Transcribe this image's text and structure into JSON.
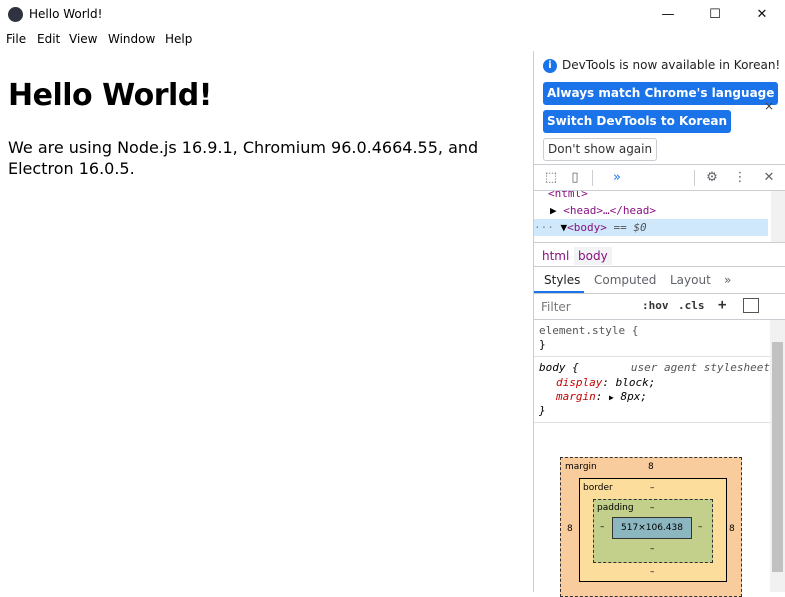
{
  "window": {
    "title": "Hello World!",
    "minimize": "—",
    "maximize": "☐",
    "close": "✕"
  },
  "menu": [
    "File",
    "Edit",
    "View",
    "Window",
    "Help"
  ],
  "page": {
    "heading": "Hello World!",
    "paragraph": "We are using Node.js 16.9.1, Chromium 96.0.4664.55, and Electron 16.0.5."
  },
  "devtools": {
    "notice": {
      "text": "DevTools is now available in Korean!",
      "btn_match": "Always match Chrome's language",
      "btn_switch": "Switch DevTools to Korean",
      "btn_dont": "Don't show again",
      "close": "×"
    },
    "elements": {
      "line_html": "<html>",
      "line_head": "<head>…</head>",
      "line_body": "<body>",
      "body_marker": "== $0"
    },
    "breadcrumbs": [
      "html",
      "body"
    ],
    "tabs": [
      "Styles",
      "Computed",
      "Layout",
      "»"
    ],
    "filter": {
      "placeholder": "Filter",
      "hov": ":hov",
      "cls": ".cls",
      "plus": "+"
    },
    "styles": {
      "element_style": "element.style {",
      "close_brace": "}",
      "body_selector": "body {",
      "ua_source": "user agent stylesheet",
      "display_prop": "display",
      "display_val": "block;",
      "margin_prop": "margin",
      "margin_val": "8px;"
    },
    "boxmodel": {
      "margin_label": "margin",
      "margin_val": "8",
      "border_label": "border",
      "border_val": "–",
      "padding_label": "padding",
      "padding_val": "–",
      "content": "517×106.438",
      "side_margin": "8",
      "dash": "–"
    }
  }
}
